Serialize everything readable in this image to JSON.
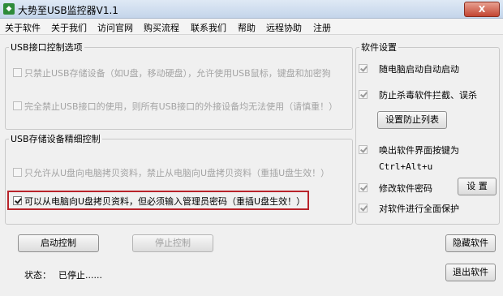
{
  "window": {
    "title": "大势至USB监控器V1.1",
    "close_label": "X"
  },
  "menu": [
    "关于软件",
    "关于我们",
    "访问官网",
    "购买流程",
    "联系我们",
    "帮助",
    "远程协助",
    "注册"
  ],
  "usb_options": {
    "legend": "USB接口控制选项",
    "items": [
      {
        "label": "只禁止USB存储设备（如U盘，移动硬盘），允许使用USB鼠标，键盘和加密狗",
        "checked": false,
        "enabled": false
      },
      {
        "label": "完全禁止USB接口的使用，则所有USB接口的外接设备均无法使用（请慎重！）",
        "checked": false,
        "enabled": false
      }
    ]
  },
  "storage_control": {
    "legend": "USB存储设备精细控制",
    "items": [
      {
        "label": "只允许从U盘向电脑拷贝资料，禁止从电脑向U盘拷贝资料（重插U盘生效！）",
        "checked": false,
        "enabled": false
      },
      {
        "label": "可以从电脑向U盘拷贝资料，但必须输入管理员密码（重插U盘生效！）",
        "checked": true,
        "enabled": true
      }
    ]
  },
  "settings": {
    "legend": "软件设置",
    "autostart_label": "随电脑启动自动启动",
    "antivirus_label": "防止杀毒软件拦截、误杀",
    "protect_list_button": "设置防止列表",
    "hotkey_label": "唤出软件界面按键为",
    "hotkey_value": "Ctrl+Alt+u",
    "password_label": "修改软件密码",
    "password_button": "设 置",
    "protect_label": "对软件进行全面保护"
  },
  "actions": {
    "start": "启动控制",
    "stop": "停止控制",
    "hide": "隐藏软件",
    "exit": "退出软件"
  },
  "status": {
    "label": "状态：",
    "value": "已停止......"
  }
}
